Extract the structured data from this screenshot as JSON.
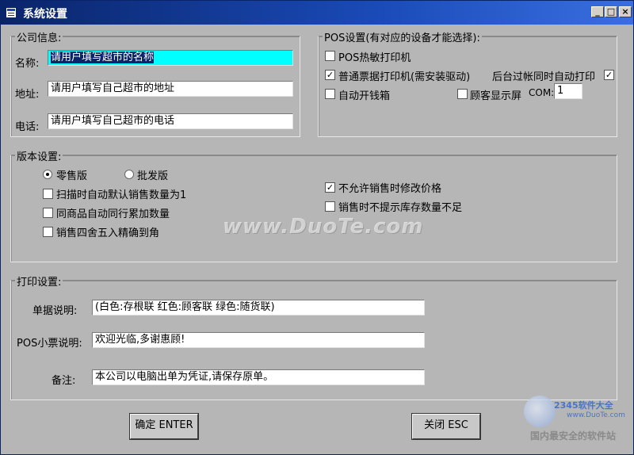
{
  "window": {
    "title": "系统设置",
    "controls": {
      "minimize": "_",
      "maximize": "□",
      "close": "×"
    }
  },
  "company": {
    "group_label": "公司信息:",
    "name_label": "名称:",
    "name_value": "请用户填写超市的名称",
    "address_label": "地址:",
    "address_value": "请用户填写自己超市的地址",
    "phone_label": "电话:",
    "phone_value": "请用户填写自己超市的电话"
  },
  "pos": {
    "group_label": "POS设置(有对应的设备才能选择):",
    "thermal_printer": {
      "label": "POS热敏打印机",
      "checked": false
    },
    "receipt_printer": {
      "label": "普通票据打印机(需安装驱动)",
      "checked": true
    },
    "auto_print": {
      "label": "后台过帐同时自动打印",
      "checked": true
    },
    "cash_drawer": {
      "label": "自动开钱箱",
      "checked": false
    },
    "customer_display": {
      "label": "顾客显示屏",
      "checked": false
    },
    "com_label": "COM:",
    "com_value": "1"
  },
  "version": {
    "group_label": "版本设置:",
    "retail": {
      "label": "零售版",
      "selected": true
    },
    "wholesale": {
      "label": "批发版",
      "selected": false
    },
    "scan_default_qty": {
      "label": "扫描时自动默认销售数量为1",
      "checked": false
    },
    "same_item_accumulate": {
      "label": "同商品自动同行累加数量",
      "checked": false
    },
    "round_to_jiao": {
      "label": "销售四舍五入精确到角",
      "checked": false
    },
    "disallow_price_change": {
      "label": "不允许销售时修改价格",
      "checked": true
    },
    "no_stock_warning": {
      "label": "销售时不提示库存数量不足",
      "checked": false
    }
  },
  "print": {
    "group_label": "打印设置:",
    "doc_note_label": "单据说明:",
    "doc_note_value": "(白色:存根联      红色:顾客联      绿色:随货联)",
    "pos_note_label": "POS小票说明:",
    "pos_note_value": "欢迎光临,多谢惠顾!",
    "remark_label": "备注:",
    "remark_value": "本公司以电脑出单为凭证,请保存原单。"
  },
  "buttons": {
    "ok": "确定 ENTER",
    "close": "关闭 ESC"
  },
  "overlay": {
    "watermark": "www.DuoTe.com",
    "brand": "2345软件大全",
    "brand_url": "www.DuoTe.com",
    "slogan": "国内最安全的软件站"
  },
  "colors": {
    "title_bar": "#0a246a",
    "window_bg": "#b6b6b6",
    "selection_highlight": "#00ffff"
  }
}
